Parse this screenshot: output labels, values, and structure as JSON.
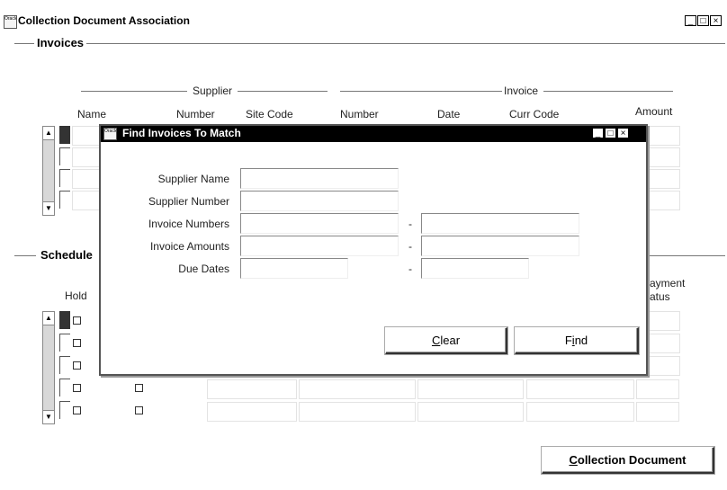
{
  "window": {
    "title": "Collection Document Association",
    "icon_text": "Oracle",
    "controls": [
      "_",
      "□",
      "×"
    ]
  },
  "invoices": {
    "section_title": "Invoices",
    "group_supplier": "Supplier",
    "group_invoice": "Invoice",
    "columns": {
      "name": "Name",
      "number": "Number",
      "site_code": "Site Code",
      "invoice_number": "Number",
      "date": "Date",
      "curr_code": "Curr Code",
      "amount": "Amount"
    },
    "row_count": 4
  },
  "schedules": {
    "section_title": "Schedule",
    "columns": {
      "hold": "Hold",
      "payment": "ayment",
      "status": "atus"
    },
    "row_count": 5
  },
  "dialog": {
    "title": "Find Invoices To Match",
    "icon_text": "Oracle",
    "fields": {
      "supplier_name": "Supplier Name",
      "supplier_number": "Supplier Number",
      "invoice_numbers": "Invoice Numbers",
      "invoice_amounts": "Invoice Amounts",
      "due_dates": "Due Dates"
    },
    "range_separator": "-",
    "buttons": {
      "clear_u": "C",
      "clear_rest": "lear",
      "find_pre": "F",
      "find_u": "i",
      "find_rest": "nd"
    }
  },
  "footer": {
    "collection_document_u": "C",
    "collection_document_rest": "ollection Document"
  }
}
